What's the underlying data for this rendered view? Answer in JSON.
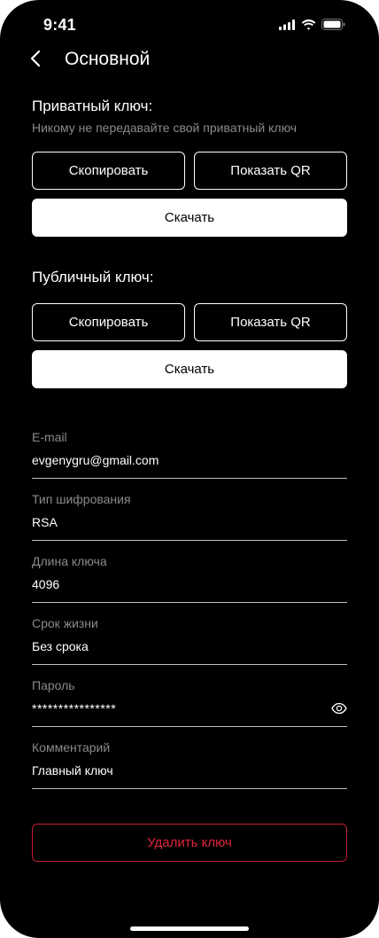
{
  "status_bar": {
    "time": "9:41"
  },
  "header": {
    "title": "Основной",
    "back_icon": "chevron-left-icon"
  },
  "private_key": {
    "title": "Приватный ключ:",
    "hint": "Никому не передавайте свой приватный ключ",
    "copy_label": "Скопировать",
    "show_qr_label": "Показать QR",
    "download_label": "Скачать"
  },
  "public_key": {
    "title": "Публичный ключ:",
    "copy_label": "Скопировать",
    "show_qr_label": "Показать QR",
    "download_label": "Скачать"
  },
  "fields": [
    {
      "label": "E-mail",
      "value": "evgenygru@gmail.com"
    },
    {
      "label": "Тип шифрования",
      "value": "RSA"
    },
    {
      "label": "Длина ключа",
      "value": "4096"
    },
    {
      "label": "Срок жизни",
      "value": "Без срока"
    },
    {
      "label": "Пароль",
      "value": "****************",
      "icon": "eye-icon"
    },
    {
      "label": "Комментарий",
      "value": "Главный ключ"
    }
  ],
  "actions": {
    "delete_label": "Удалить ключ"
  },
  "colors": {
    "background": "#000000",
    "text": "#ffffff",
    "muted": "#8a8a8a",
    "danger": "#e0243c"
  }
}
